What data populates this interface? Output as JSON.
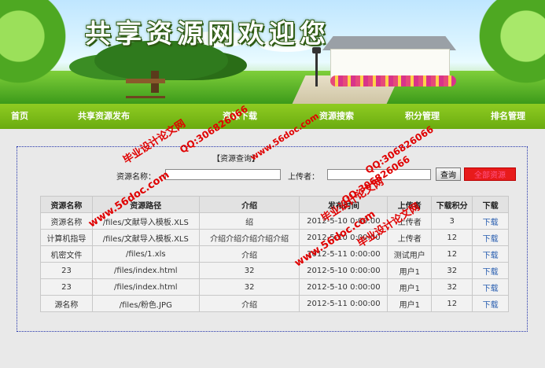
{
  "banner": {
    "title": "共享资源网欢迎您"
  },
  "nav": {
    "items": [
      "首页",
      "共享资源发布",
      "资源下载",
      "资源搜索",
      "积分管理",
      "排名管理"
    ]
  },
  "query": {
    "title": "【资源查询】",
    "name_label": "资源名称：",
    "name_value": "",
    "uploader_label": "上传者：",
    "uploader_value": "",
    "query_button": "查询",
    "red_button": "全部资源"
  },
  "table": {
    "headers": [
      "资源名称",
      "资源路径",
      "介绍",
      "发布时间",
      "上传者",
      "下载积分",
      "下载"
    ],
    "rows": [
      [
        "资源名称",
        "/files/文献导入模板.XLS",
        "绍",
        "2012-5-10 0:00:00",
        "上传者",
        "3",
        "下载"
      ],
      [
        "计算机指导",
        "/files/文献导入模板.XLS",
        "介绍介绍介绍介绍介绍",
        "2012-5-10 0:00:00",
        "上传者",
        "12",
        "下载"
      ],
      [
        "机密文件",
        "/files/1.xls",
        "介绍",
        "2012-5-11 0:00:00",
        "测试用户",
        "12",
        "下载"
      ],
      [
        "23",
        "/files/index.html",
        "32",
        "2012-5-10 0:00:00",
        "用户1",
        "32",
        "下载"
      ],
      [
        "23",
        "/files/index.html",
        "32",
        "2012-5-10 0:00:00",
        "用户1",
        "32",
        "下载"
      ],
      [
        "源名称",
        "/files/粉色.JPG",
        "介绍",
        "2012-5-11 0:00:00",
        "用户1",
        "12",
        "下载"
      ]
    ]
  },
  "watermarks": {
    "cn1": "毕业设计论文网",
    "qq1": "QQ:306826066",
    "url1": "www.56doc.com",
    "cn2": "毕业设计论文网",
    "qq2": "QQ:306826066",
    "url2": "www.56doc.com",
    "url3": "www.56doc.com",
    "qq3": "QQ:306826066",
    "cn3": "毕业设计论文网"
  },
  "colors": {
    "nav_bg": "#7bbd18",
    "content_bg": "#e9e9e9",
    "link": "#2a5fb0",
    "watermark": "#e00000",
    "red_button": "#e81b1b"
  }
}
